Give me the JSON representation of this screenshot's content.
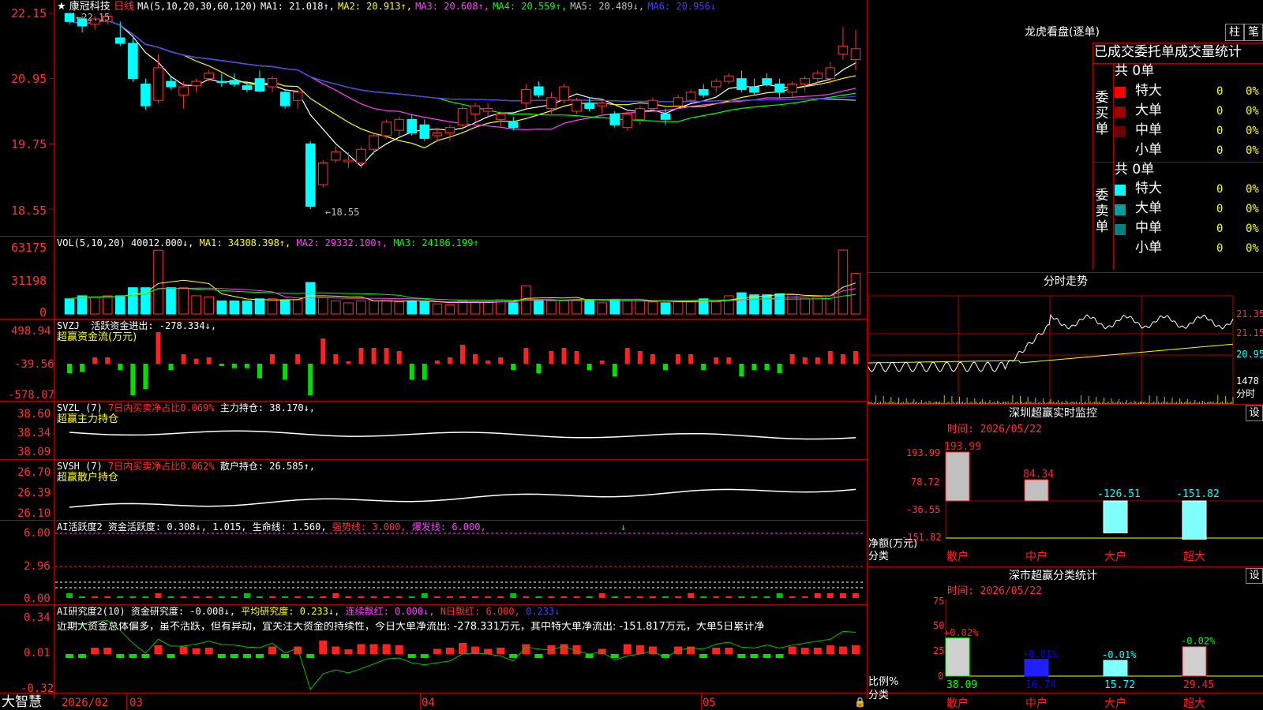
{
  "stock": {
    "star": "★",
    "name": "康冠科技",
    "period": "日线"
  },
  "ma_header": {
    "label": "MA(5,10,20,30,60,120)",
    "ma1": "MA1: 21.018↑,",
    "ma2": "MA2: 20.913↑,",
    "ma3": "MA3: 20.608↑,",
    "ma4": "MA4: 20.559↑,",
    "ma5": "MA5: 20.489↓,",
    "ma6": "MA6: 20.956↓"
  },
  "price_axis": [
    "22.15",
    "20.95",
    "19.75",
    "18.55"
  ],
  "price_marks": {
    "high": "←22.15",
    "low": "←18.55"
  },
  "vol_header": {
    "label": "VOL(5,10,20)",
    "value": "40012.000↓,",
    "ma1": "MA1: 34308.398↑,",
    "ma2": "MA2: 29332.100↑,",
    "ma3": "MA3: 24186.199↑"
  },
  "vol_axis": [
    "63175",
    "31198",
    "0"
  ],
  "svzj": {
    "label": "SVZJ",
    "desc": "活跃资金进出: -278.334↓,",
    "sub": "超赢资金流(万元)",
    "axis": [
      "498.94",
      "-39.56",
      "-578.07"
    ]
  },
  "svzl": {
    "label": "SVZL (7)",
    "desc": "7日内买卖净占比0.069%",
    "hold": "主力持仓: 38.170↓,",
    "sub": "超赢主力持仓",
    "axis": [
      "38.60",
      "38.34",
      "38.09"
    ]
  },
  "svsh": {
    "label": "SVSH (7)",
    "desc": "7日内买卖净占比0.062%",
    "hold": "散户持仓: 26.585↑,",
    "sub": "超赢散户持仓",
    "axis": [
      "26.70",
      "26.39",
      "26.10"
    ]
  },
  "ai_active": {
    "label": "AI活跃度2",
    "v1": "资金活跃度: 0.308↓,",
    "v2": "1.015,",
    "v3": "生命线: 1.560,",
    "v4": "强势线: 3.000,",
    "v5": "爆发线: 6.000,",
    "arrow": "↓",
    "axis": [
      "6.00",
      "2.96",
      "0.00"
    ]
  },
  "ai_research": {
    "label": "AI研究度2(10)",
    "v1": "资金研究度: -0.008↓,",
    "v2": "平均研究度: 0.233↓,",
    "v3": "连续飘红: 0.000↓,",
    "v4": "N日飘红: 6.000,",
    "v5": "0.233↓",
    "comment": "近期大资金总体偏多，虽不活跃，但有异动，宜关注大资金的持续性，今日大单净流出: -278.331万元，其中特大单净流出: -151.817万元，大单5日累计净",
    "axis": [
      "0.34",
      "0.01",
      "-0.32"
    ]
  },
  "bottom_bar": {
    "brand": "大智慧",
    "dates": [
      "2026/02",
      "03",
      "04",
      "05"
    ]
  },
  "right": {
    "lhb_title": "龙虎看盘(逐单)",
    "btn_bar": "柱",
    "btn_pen": "笔",
    "tabs": [
      "已成交委托单成交量统计"
    ],
    "buy_side": "委买单",
    "sell_side": "委卖单",
    "buy_total": "共 0单",
    "sell_total": "共 0单",
    "buy_rows": [
      {
        "name": "特大",
        "count": "0",
        "pct": "0%",
        "color": "#ff0000"
      },
      {
        "name": "大单",
        "count": "0",
        "pct": "0%",
        "color": "#a00000"
      },
      {
        "name": "中单",
        "count": "0",
        "pct": "0%",
        "color": "#700000"
      },
      {
        "name": "小单",
        "count": "0",
        "pct": "0%",
        "color": ""
      }
    ],
    "sell_rows": [
      {
        "name": "特大",
        "count": "0",
        "pct": "0%",
        "color": "#00ffff"
      },
      {
        "name": "大单",
        "count": "0",
        "pct": "0%",
        "color": "#00a0a0"
      },
      {
        "name": "中单",
        "count": "0",
        "pct": "0%",
        "color": "#008080"
      },
      {
        "name": "小单",
        "count": "0",
        "pct": "0%",
        "color": ""
      }
    ],
    "intraday_title": "分时走势",
    "intraday_axis": [
      "21.35",
      "21.15",
      "20.95"
    ],
    "intraday_vol": "1478",
    "intraday_vol_unit": "分时",
    "sz_monitor": {
      "title": "深圳超赢实时监控",
      "set": "设",
      "time": "时间: 2026/05/22",
      "axis": [
        "193.99",
        "78.72",
        "-36.55",
        "-151.82"
      ],
      "unit": "净额(万元)",
      "cat_label": "分类",
      "bars": [
        {
          "name": "散户",
          "value": "193.99"
        },
        {
          "name": "中户",
          "value": "84.34"
        },
        {
          "name": "大户",
          "value": "-126.51"
        },
        {
          "name": "超大",
          "value": "-151.82"
        }
      ]
    },
    "sz_classify": {
      "title": "深市超赢分类统计",
      "set": "设",
      "time": "时间: 2026/05/22",
      "axis": [
        "75",
        "50",
        "25",
        "0"
      ],
      "unit": "比例%",
      "cat_label": "分类",
      "bars": [
        {
          "name": "散户",
          "value": "38.09",
          "chg": "+0.02%"
        },
        {
          "name": "中户",
          "value": "16.74",
          "chg": "+0.01%"
        },
        {
          "name": "大户",
          "value": "15.72",
          "chg": "-0.01%"
        },
        {
          "name": "超大",
          "value": "29.45",
          "chg": "-0.02%"
        }
      ]
    }
  },
  "chart_data": {
    "type": "candlestick",
    "ohlc": [
      [
        22.15,
        22.1,
        21.95,
        22.0
      ],
      [
        22.05,
        22.1,
        21.8,
        21.92
      ],
      [
        21.95,
        22.1,
        21.85,
        22.05
      ],
      [
        22.0,
        22.15,
        21.95,
        22.1
      ],
      [
        21.7,
        22.0,
        21.55,
        21.6
      ],
      [
        21.6,
        21.7,
        20.9,
        20.95
      ],
      [
        20.85,
        20.95,
        20.38,
        20.45
      ],
      [
        20.55,
        21.4,
        20.5,
        21.15
      ],
      [
        20.9,
        21.0,
        20.75,
        20.8
      ],
      [
        20.65,
        20.9,
        20.4,
        20.8
      ],
      [
        20.82,
        20.95,
        20.7,
        20.9
      ],
      [
        20.95,
        21.1,
        20.9,
        21.05
      ],
      [
        20.9,
        21.05,
        20.8,
        20.88
      ],
      [
        20.92,
        21.05,
        20.8,
        20.85
      ],
      [
        20.82,
        20.9,
        20.7,
        20.75
      ],
      [
        20.95,
        21.1,
        20.7,
        20.72
      ],
      [
        20.8,
        21.0,
        20.7,
        20.95
      ],
      [
        20.7,
        20.75,
        20.4,
        20.45
      ],
      [
        20.55,
        20.75,
        20.4,
        20.7
      ],
      [
        19.75,
        19.8,
        18.55,
        18.6
      ],
      [
        19.0,
        19.45,
        18.95,
        19.4
      ],
      [
        19.45,
        19.7,
        19.4,
        19.6
      ],
      [
        19.42,
        19.6,
        19.3,
        19.45
      ],
      [
        19.4,
        19.7,
        19.3,
        19.65
      ],
      [
        19.65,
        19.95,
        19.55,
        19.9
      ],
      [
        19.9,
        20.2,
        19.85,
        20.15
      ],
      [
        20.0,
        20.25,
        19.9,
        20.2
      ],
      [
        20.2,
        20.3,
        19.9,
        19.95
      ],
      [
        20.1,
        20.2,
        19.8,
        19.85
      ],
      [
        19.9,
        20.05,
        19.8,
        19.95
      ],
      [
        19.95,
        20.1,
        19.8,
        20.05
      ],
      [
        20.1,
        20.45,
        20.0,
        20.4
      ],
      [
        20.3,
        20.5,
        20.15,
        20.45
      ],
      [
        20.35,
        20.5,
        20.25,
        20.4
      ],
      [
        20.2,
        20.35,
        20.05,
        20.3
      ],
      [
        20.15,
        20.25,
        20.0,
        20.05
      ],
      [
        20.5,
        20.85,
        20.4,
        20.75
      ],
      [
        20.8,
        20.9,
        20.6,
        20.65
      ],
      [
        20.4,
        20.7,
        20.3,
        20.6
      ],
      [
        20.55,
        20.85,
        20.5,
        20.8
      ],
      [
        20.35,
        20.6,
        20.3,
        20.55
      ],
      [
        20.5,
        20.6,
        20.35,
        20.4
      ],
      [
        20.45,
        20.55,
        20.3,
        20.5
      ],
      [
        20.3,
        20.35,
        20.05,
        20.1
      ],
      [
        20.05,
        20.35,
        20.0,
        20.3
      ],
      [
        20.2,
        20.45,
        20.1,
        20.4
      ],
      [
        20.4,
        20.6,
        20.35,
        20.55
      ],
      [
        20.3,
        20.4,
        20.1,
        20.2
      ],
      [
        20.45,
        20.65,
        20.4,
        20.6
      ],
      [
        20.55,
        20.75,
        20.5,
        20.7
      ],
      [
        20.75,
        20.85,
        20.6,
        20.65
      ],
      [
        20.8,
        20.95,
        20.7,
        20.9
      ],
      [
        20.9,
        21.05,
        20.85,
        21.0
      ],
      [
        20.95,
        21.1,
        20.7,
        20.75
      ],
      [
        20.8,
        20.95,
        20.65,
        20.7
      ],
      [
        20.95,
        21.05,
        20.8,
        20.85
      ],
      [
        20.85,
        20.95,
        20.6,
        20.7
      ],
      [
        20.7,
        20.9,
        20.6,
        20.85
      ],
      [
        20.85,
        21.0,
        20.7,
        20.95
      ],
      [
        20.95,
        21.1,
        20.85,
        21.05
      ],
      [
        20.95,
        21.25,
        20.85,
        21.15
      ],
      [
        21.4,
        21.9,
        21.3,
        21.55
      ],
      [
        21.3,
        21.85,
        21.1,
        21.5
      ]
    ],
    "volume": [
      15000,
      18000,
      17000,
      18000,
      18000,
      26000,
      26000,
      63000,
      26000,
      26000,
      18000,
      17000,
      13000,
      13000,
      13000,
      15000,
      15000,
      14000,
      14000,
      31198,
      16000,
      13000,
      11000,
      13000,
      13000,
      14000,
      12000,
      13000,
      12000,
      10000,
      9000,
      13000,
      12000,
      12000,
      14000,
      11000,
      28000,
      14000,
      13000,
      13000,
      14000,
      14000,
      11000,
      14000,
      13000,
      13000,
      12000,
      11000,
      12000,
      12000,
      15000,
      12000,
      18000,
      21000,
      19000,
      19000,
      20000,
      19000,
      15000,
      17000,
      18000,
      63175,
      40012
    ],
    "ma_legend": [
      "MA1",
      "MA2",
      "MA3",
      "MA4",
      "MA5",
      "MA6"
    ],
    "ma_colors": [
      "#ffffff",
      "#ffff00",
      "#ff40ff",
      "#00ff00",
      "#c0c0c0",
      "#4040ff"
    ],
    "ylim": [
      18.55,
      22.15
    ],
    "x_labels": [
      "2026/02",
      "03",
      "04",
      "05"
    ]
  },
  "colors": {
    "up": "#ff3030",
    "down": "#00ffff",
    "frame": "#b00000"
  }
}
